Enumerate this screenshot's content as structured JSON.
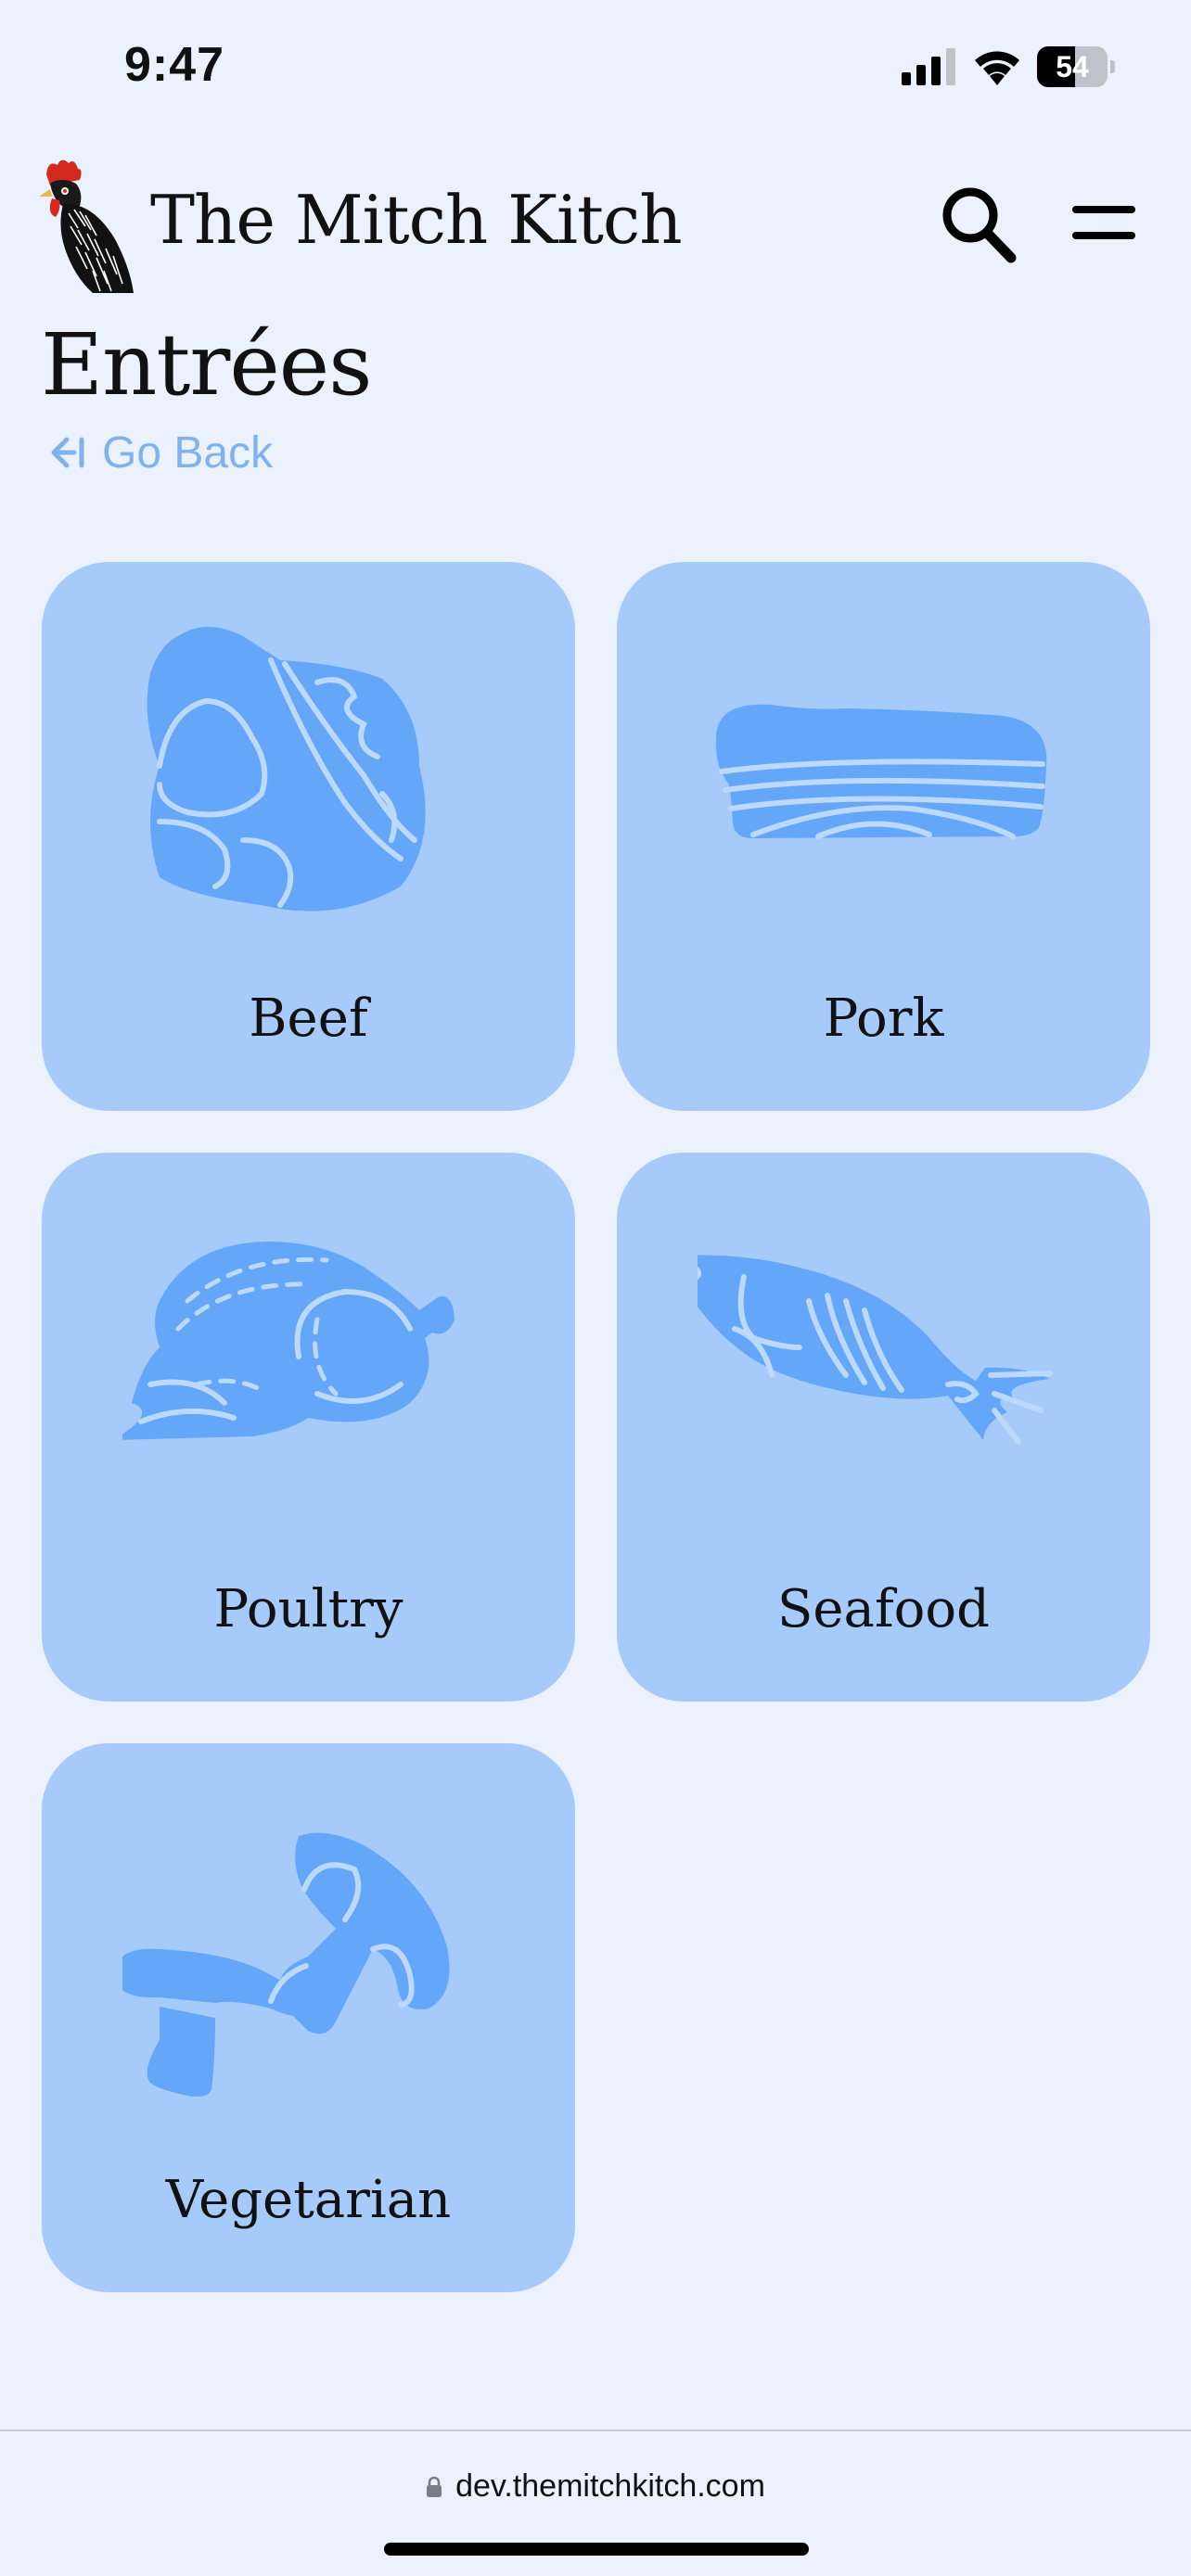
{
  "status": {
    "time": "9:47",
    "battery": "54",
    "battery_level": 0.54
  },
  "header": {
    "site_title": "The Mitch Kitch",
    "logo": "rooster-logo-icon",
    "search_icon": "search-icon",
    "menu_icon": "hamburger-menu-icon"
  },
  "page": {
    "title": "Entrées",
    "back_label": "Go Back",
    "back_icon": "arrow-left-bar-icon"
  },
  "categories": [
    {
      "label": "Beef",
      "icon": "beef-icon"
    },
    {
      "label": "Pork",
      "icon": "pork-icon"
    },
    {
      "label": "Poultry",
      "icon": "poultry-icon"
    },
    {
      "label": "Seafood",
      "icon": "fish-icon"
    },
    {
      "label": "Vegetarian",
      "icon": "mushroom-icon"
    }
  ],
  "browser": {
    "url": "dev.themitchkitch.com"
  },
  "colors": {
    "background": "#ebf2fe",
    "card": "#a6cbfa",
    "icon_fill": "#64a6f7",
    "icon_line": "#bcd8fb",
    "link": "#7fb3ef",
    "text": "#111111"
  }
}
